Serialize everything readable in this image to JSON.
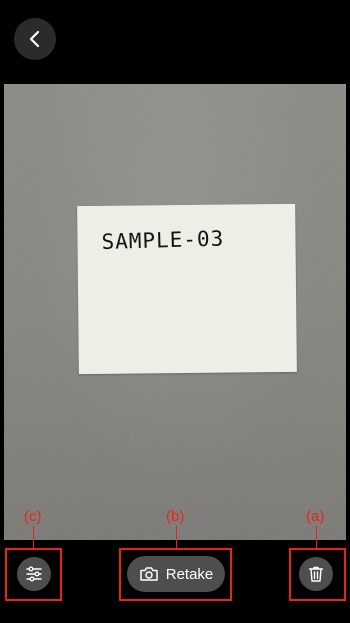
{
  "header": {
    "back_icon": "chevron-left-icon"
  },
  "photo": {
    "note_text": "SAMPLE-03"
  },
  "toolbar": {
    "adjust_icon": "sliders-icon",
    "retake_icon": "camera-icon",
    "retake_label": "Retake",
    "delete_icon": "trash-icon"
  },
  "annotations": {
    "a": "(a)",
    "b": "(b)",
    "c": "(c)",
    "color": "#e8241a"
  }
}
